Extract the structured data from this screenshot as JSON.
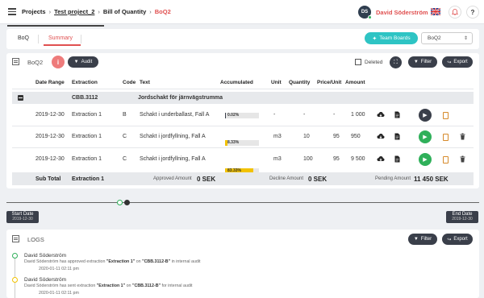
{
  "breadcrumb": {
    "root": "Projects",
    "project": "Test project_2",
    "section": "Bill of Quantity",
    "current": "BoQ2"
  },
  "user": {
    "initials": "DS",
    "name": "David Söderström"
  },
  "tabs": [
    "BoQ",
    "Summary"
  ],
  "team_boards_label": "Team Boards",
  "boq_select": "BoQ2",
  "card_title": "BoQ2",
  "buttons": {
    "info": "i",
    "audit": "Audit",
    "deleted": "Deleted",
    "filter": "Filter",
    "export": "Export"
  },
  "table": {
    "headers": [
      "Date Range",
      "Extraction",
      "Code",
      "Text",
      "Accumulated",
      "Unit",
      "Quantity",
      "Price/Unit",
      "Amount"
    ],
    "group": {
      "code": "CBB.3112",
      "text": "Jordschakt för järnvägstrumma"
    },
    "rows": [
      {
        "date": "2019-12-30",
        "extraction": "Extraction 1",
        "code": "B",
        "text": "Schakt i underballast, Fall A",
        "accumulated": "0.02%",
        "accumulated_value": 0.02,
        "bar_color": "#3a3f4a",
        "unit": "-",
        "quantity": "-",
        "price": "-",
        "amount": "1 000",
        "action_color": "#3a3f4a",
        "deletable": false
      },
      {
        "date": "2019-12-30",
        "extraction": "Extraction 1",
        "code": "C",
        "text": "Schakt i jordfyllning, Fall A",
        "accumulated": "8.33%",
        "accumulated_value": 8.33,
        "bar_color": "#f2c200",
        "unit": "m3",
        "quantity": "10",
        "price": "95",
        "amount": "950",
        "action_color": "#2fb05a",
        "deletable": true
      },
      {
        "date": "2019-12-30",
        "extraction": "Extraction 1",
        "code": "C",
        "text": "Schakt i jordfyllning, Fall A",
        "accumulated": "83.33%",
        "accumulated_value": 83.33,
        "bar_color": "#f2c200",
        "unit": "m3",
        "quantity": "100",
        "price": "95",
        "amount": "9 500",
        "action_color": "#2fb05a",
        "deletable": true
      }
    ],
    "subtotal": {
      "label": "Sub Total",
      "extraction": "Extraction 1",
      "approved_label": "Approved Amount",
      "approved_value": "0 SEK",
      "decline_label": "Decline Amount",
      "decline_value": "0 SEK",
      "pending_label": "Pending Amount",
      "pending_value": "11 450 SEK"
    }
  },
  "timeline": {
    "start_label": "Start Date",
    "start_date": "2019-12-30",
    "end_label": "End Date",
    "end_date": "2019-12-30"
  },
  "logs": {
    "title": "LOGS",
    "entries": [
      {
        "user": "David Söderström",
        "prefix": "David Söderström has approved extraction ",
        "extraction": "\"Extraction 1\"",
        "mid": " on ",
        "item": "\"CBB.3112-B\"",
        "suffix": " in internal audit",
        "time": "2020-01-11 02:11 pm",
        "color": "#2fb05a"
      },
      {
        "user": "David Söderström",
        "prefix": "David Söderström has sent extraction ",
        "extraction": "\"Extraction 1\"",
        "mid": " on ",
        "item": "\"CBB.3112-B\"",
        "suffix": " for internal audit",
        "time": "2020-01-11 02:11 pm",
        "color": "#f2c200"
      }
    ]
  }
}
